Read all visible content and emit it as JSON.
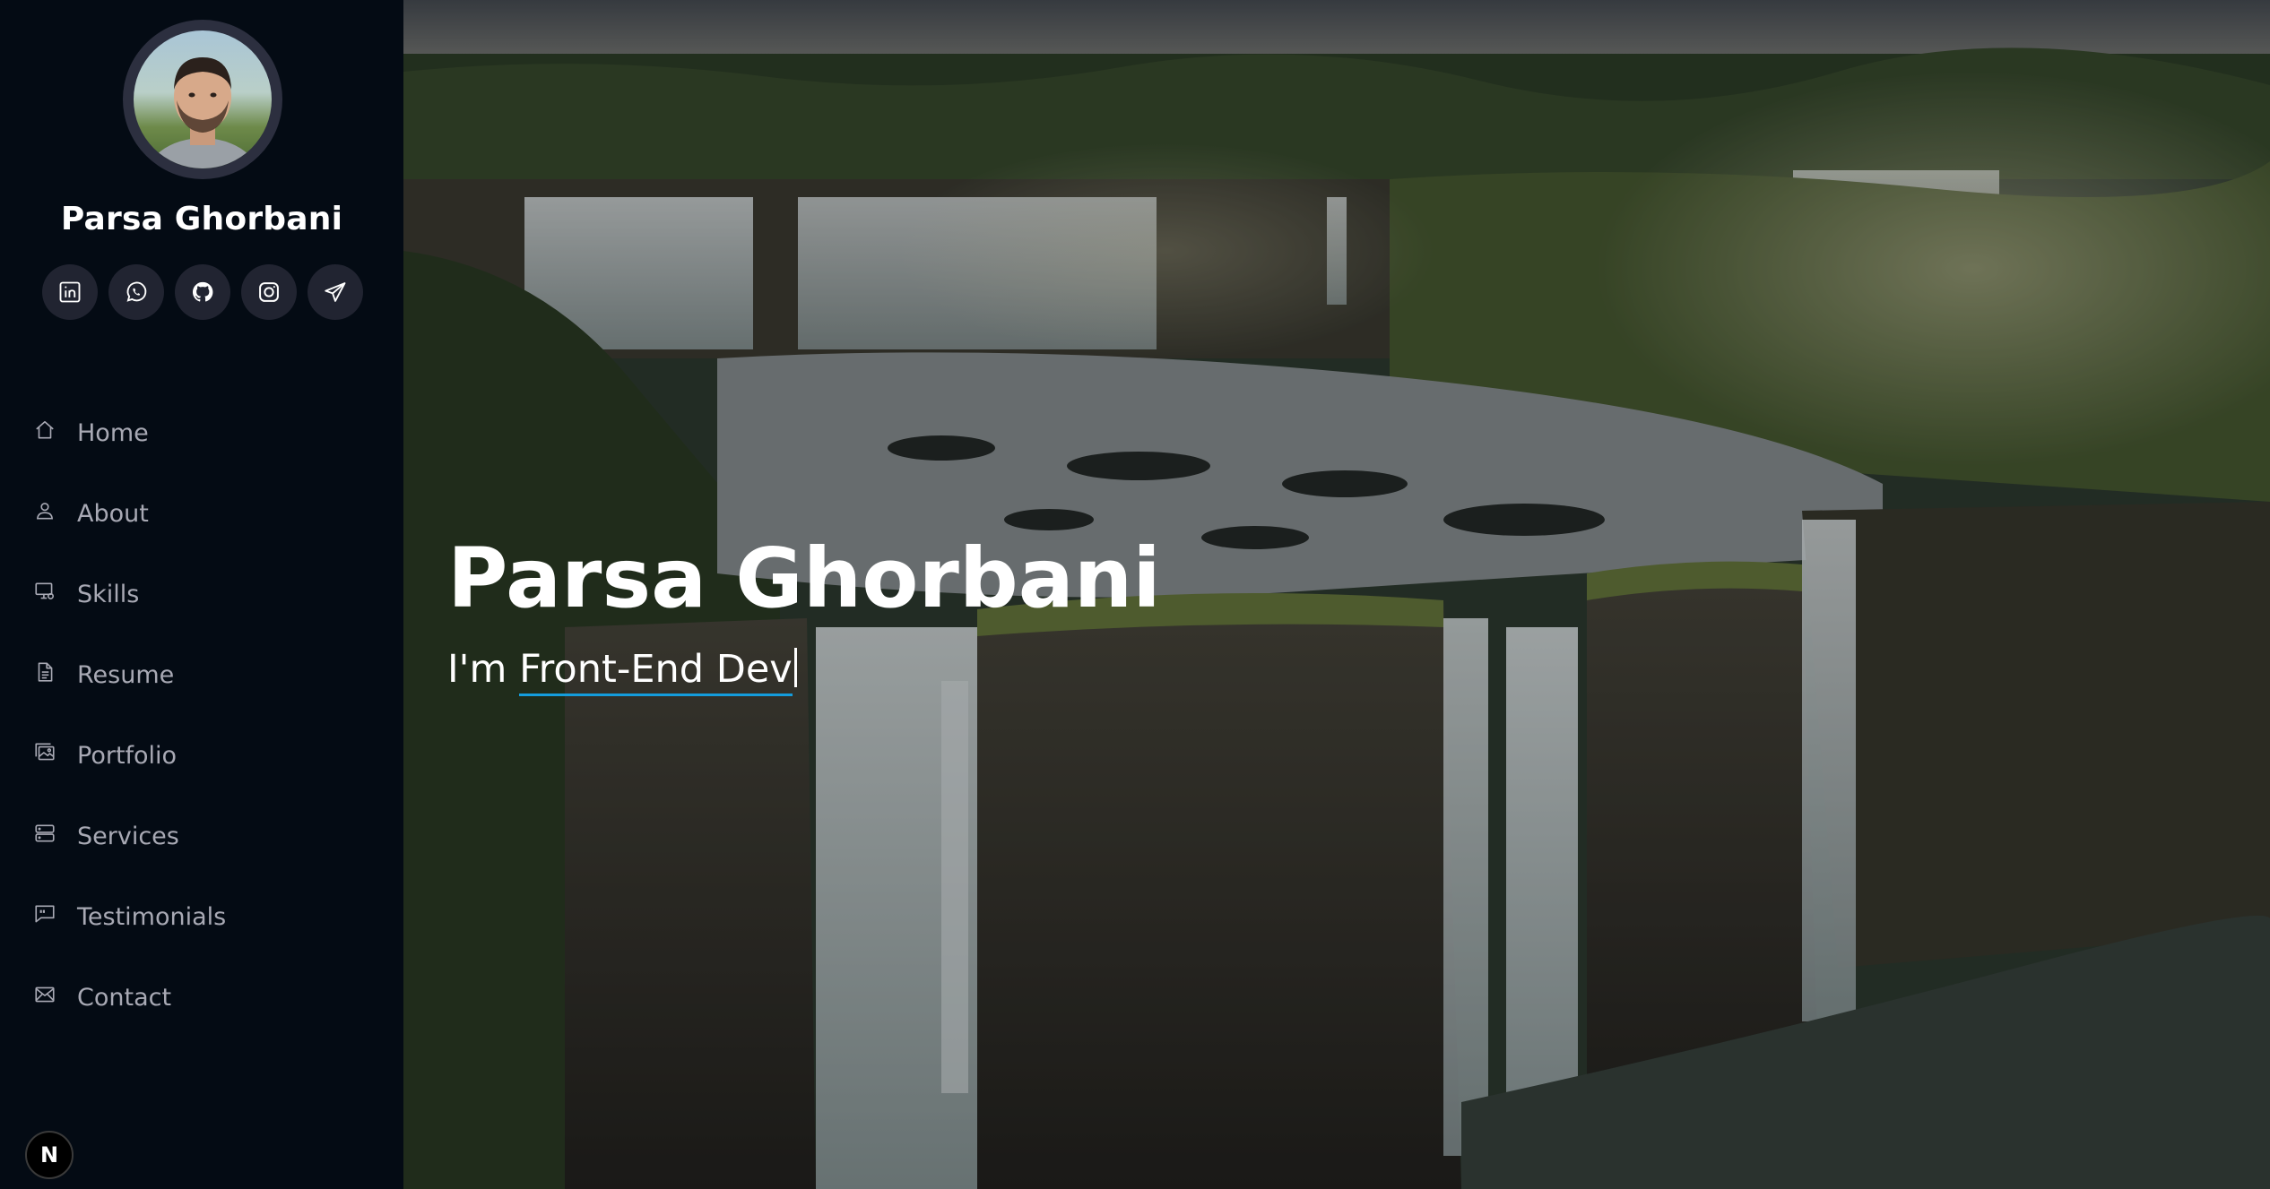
{
  "profile": {
    "name": "Parsa Ghorbani"
  },
  "socials": [
    {
      "name": "linkedin",
      "icon": "linkedin-icon"
    },
    {
      "name": "whatsapp",
      "icon": "whatsapp-icon"
    },
    {
      "name": "github",
      "icon": "github-icon"
    },
    {
      "name": "instagram",
      "icon": "instagram-icon"
    },
    {
      "name": "telegram",
      "icon": "telegram-icon"
    }
  ],
  "nav": [
    {
      "label": "Home",
      "icon": "home-icon"
    },
    {
      "label": "About",
      "icon": "person-icon"
    },
    {
      "label": "Skills",
      "icon": "pc-display-icon"
    },
    {
      "label": "Resume",
      "icon": "file-text-icon"
    },
    {
      "label": "Portfolio",
      "icon": "images-icon"
    },
    {
      "label": "Services",
      "icon": "hdd-stack-icon"
    },
    {
      "label": "Testimonials",
      "icon": "chat-quote-icon"
    },
    {
      "label": "Contact",
      "icon": "envelope-icon"
    }
  ],
  "hero": {
    "title": "Parsa Ghorbani",
    "prefix": "I'm ",
    "typed": "Front-End Dev"
  },
  "badge": {
    "label": "N"
  },
  "colors": {
    "sidebar_bg": "#040b14",
    "accent": "#149ddd",
    "nav_text": "#a8a9b4",
    "social_bg": "#212431"
  }
}
